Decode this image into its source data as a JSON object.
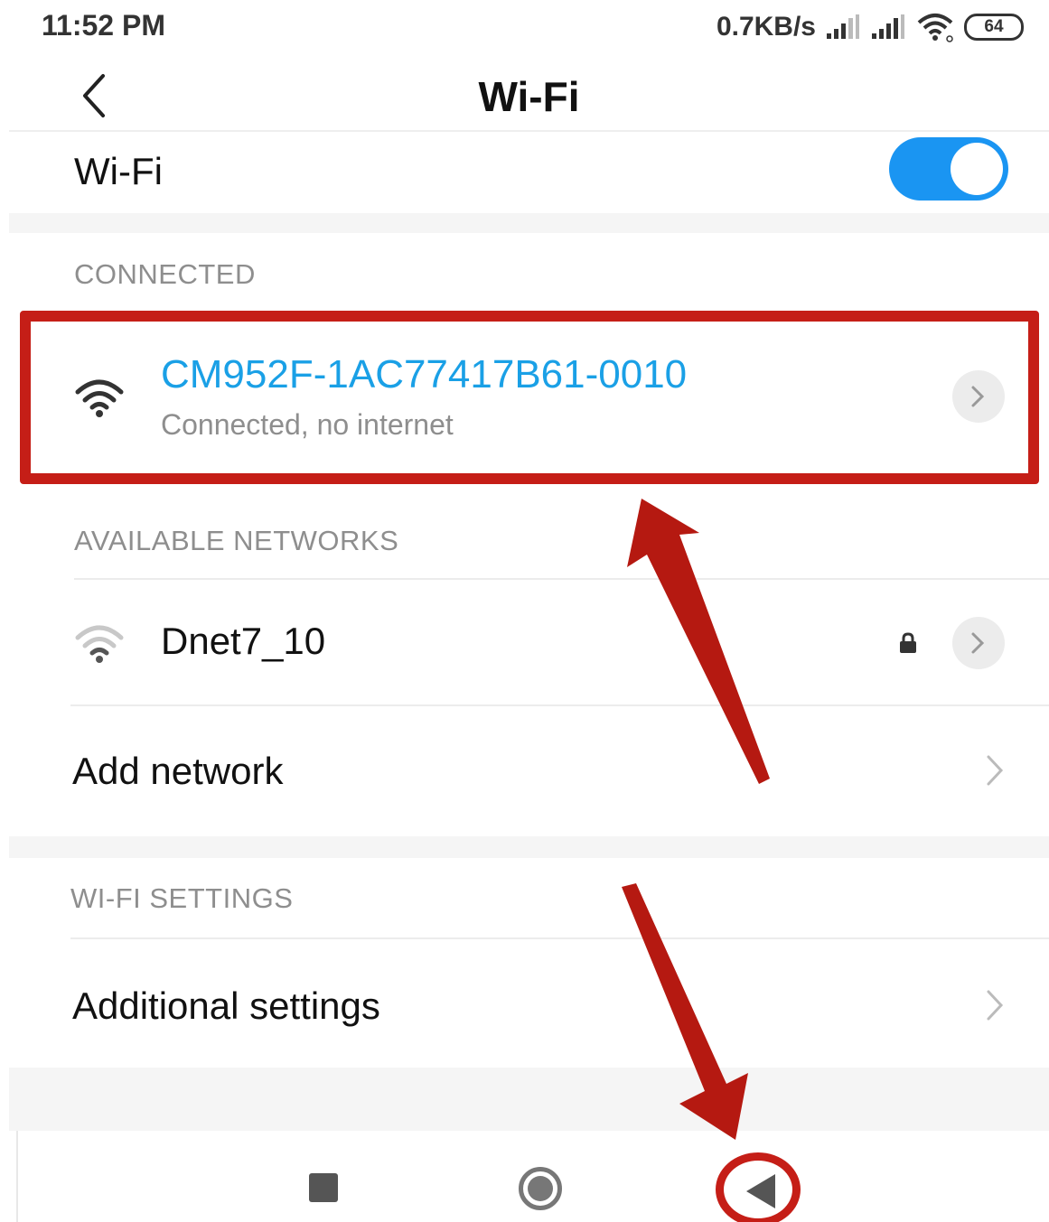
{
  "status_bar": {
    "time": "11:52 PM",
    "speed": "0.7KB/s",
    "battery": "64",
    "icons": [
      "cell-signal-icon",
      "cell-signal-icon",
      "wifi-icon",
      "battery-icon"
    ]
  },
  "header": {
    "title": "Wi-Fi"
  },
  "wifi_toggle": {
    "label": "Wi-Fi",
    "state": "on",
    "accent_color": "#1a95f2"
  },
  "connected": {
    "section_label": "CONNECTED",
    "network_name": "CM952F-1AC77417B61-0010",
    "status": "Connected, no internet",
    "name_color": "#1aa0e6"
  },
  "available": {
    "section_label": "AVAILABLE NETWORKS",
    "networks": [
      {
        "name": "Dnet7_10",
        "locked": true
      }
    ]
  },
  "add_network": {
    "label": "Add network"
  },
  "wifi_settings": {
    "section_label": "WI-FI SETTINGS",
    "additional_label": "Additional settings"
  },
  "annotation": {
    "highlight_color": "#c51e17"
  }
}
